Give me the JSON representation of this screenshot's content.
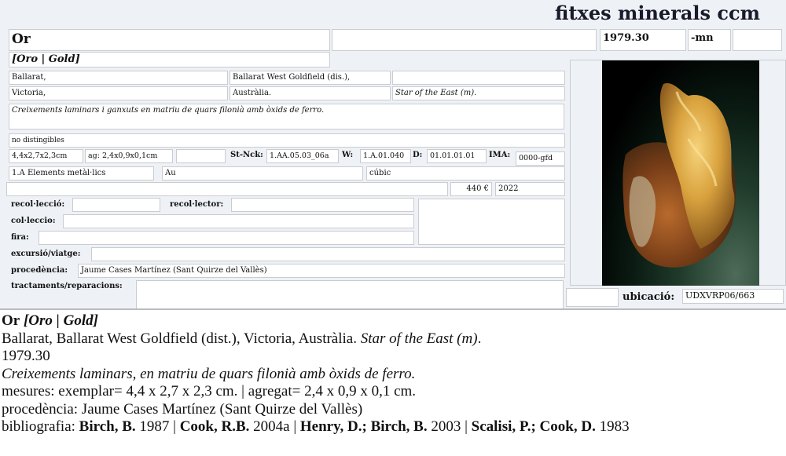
{
  "app_title": "fitxes minerals ccm",
  "card": {
    "name": "Or",
    "name_extra": "",
    "catalog_number": "1979.30",
    "suffix": "-mn",
    "suffix_extra": "",
    "synonyms": "[Oro | Gold]",
    "locality1": "Ballarat,",
    "locality2": "Ballarat West Goldfield (dis.),",
    "locality3": "",
    "region": "Victoria,",
    "country": "Austràlia.",
    "mine": "Star of the East (m).",
    "description": "Creixements laminars i ganxuts en matriu de quars filonià amb òxids de ferro.",
    "associates": "no distingibles",
    "size_specimen": "4,4x2,7x2,3cm",
    "size_aggregate": "ag: 2,4x0,9x0,1cm",
    "size_extra": "",
    "strunz_label": "St-Nck:",
    "strunz_value": "1.AA.05.03_06a",
    "w_label": "W:",
    "w_value": "1.A.01.040",
    "d_label": "D:",
    "d_value": "01.01.01.01",
    "ima_label": "IMA:",
    "ima_value": "0000-gfd",
    "class": "1.A Elements metàl·lics",
    "formula": "Au",
    "crystal_system": "cúbic",
    "notes_line": "",
    "price": "440 €",
    "year": "2022",
    "recollection_label": "recol·lecció:",
    "recollection_value": "",
    "recollector_label": "recol·lector:",
    "recollector_value": "",
    "collection_label": "col·leccio:",
    "collection_value": "",
    "fair_label": "fira:",
    "fair_value": "",
    "side_notes": "",
    "trip_label": "excursió/viatge:",
    "trip_value": "",
    "provenance_label": "procedència:",
    "provenance_value": "Jaume Cases Martínez (Sant Quirze del Vallès)",
    "treatments_label": "tractaments/reparacions:",
    "treatments_value": "",
    "location_extra": "",
    "location_label": "ubicació:",
    "location_value": "UDXVRP06/663",
    "photo_alt": "gold specimen photo"
  },
  "report": {
    "name": "Or",
    "synonyms": "[Oro | Gold]",
    "locality": "Ballarat, Ballarat West Goldfield (dist.), Victoria, Austràlia.",
    "mine": "Star of the East (m)",
    "mine_end": ".",
    "catalog_number": "1979.30",
    "description": "Creixements laminars, en matriu de quars filonià amb òxids de ferro.",
    "measures": "mesures: exemplar= 4,4 x 2,7 x 2,3 cm. | agregat= 2,4 x 0,9 x 0,1 cm.",
    "provenance": "procedència: Jaume Cases Martínez (Sant Quirze del Vallès)",
    "bibliography_label": "bibliografia: ",
    "bibliography": [
      {
        "author": "Birch, B.",
        "year": " 1987",
        "sep": " | "
      },
      {
        "author": "Cook, R.B.",
        "year": " 2004a",
        "sep": " | "
      },
      {
        "author": "Henry, D.; Birch, B.",
        "year": " 2003",
        "sep": " | "
      },
      {
        "author": "Scalisi, P.; Cook, D.",
        "year": " 1983",
        "sep": ""
      }
    ]
  }
}
